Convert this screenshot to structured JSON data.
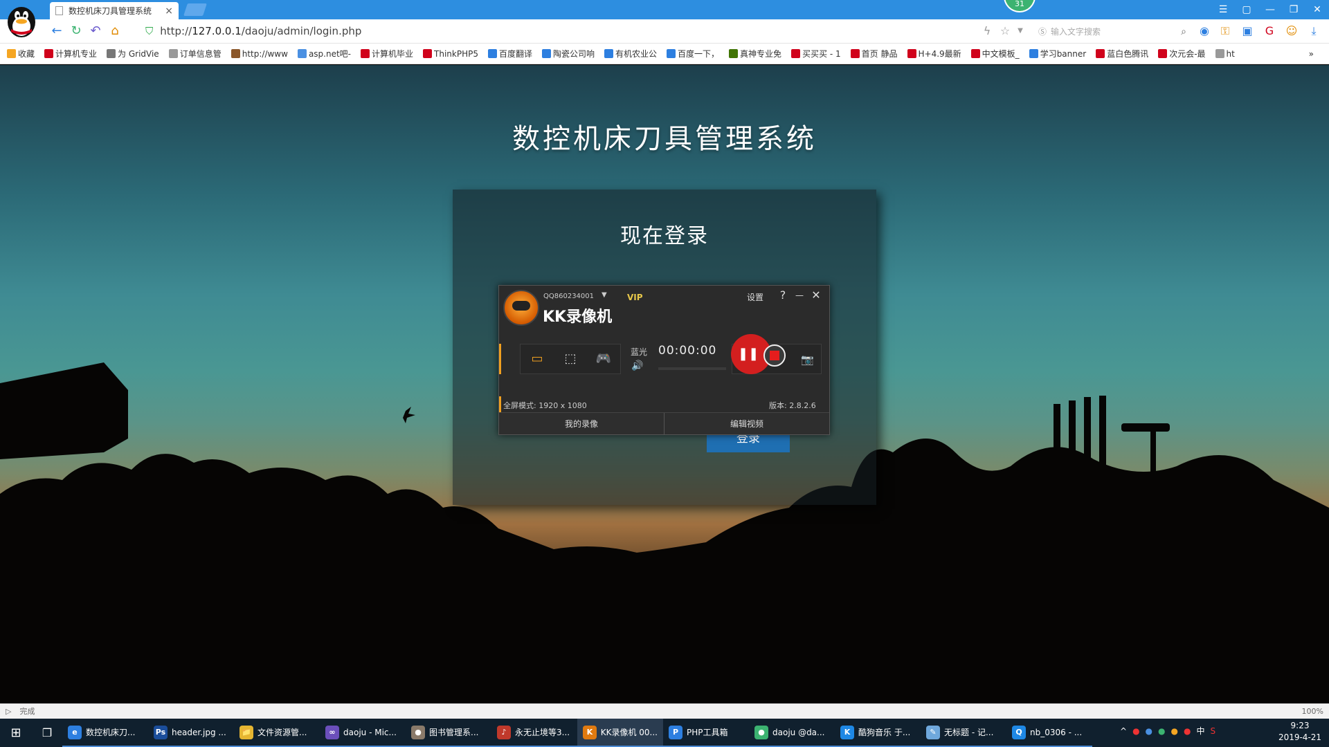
{
  "browser": {
    "tab_title": "数控机床刀具管理系统",
    "tab_close": "×",
    "url_prefix": "http://",
    "url_host": "127.0.0.1",
    "url_path": "/daoju/admin/login.php",
    "search_placeholder": "输入文字搜索",
    "notification_count": "31",
    "status_text": "完成",
    "zoom": "100%"
  },
  "bookmarks": [
    {
      "label": "收藏",
      "color": "#f5a623"
    },
    {
      "label": "计算机专业",
      "color": "#d0021b"
    },
    {
      "label": "为 GridVie",
      "color": "#777777"
    },
    {
      "label": "订单信息管",
      "color": "#999999"
    },
    {
      "label": "http://www",
      "color": "#8b572a"
    },
    {
      "label": "asp.net吧-",
      "color": "#4a90e2"
    },
    {
      "label": "计算机毕业",
      "color": "#d0021b"
    },
    {
      "label": "ThinkPHP5",
      "color": "#d0021b"
    },
    {
      "label": "百度翻译",
      "color": "#2d7fe0"
    },
    {
      "label": "陶瓷公司响",
      "color": "#2d7fe0"
    },
    {
      "label": "有机农业公",
      "color": "#2d7fe0"
    },
    {
      "label": "百度一下，",
      "color": "#2d7fe0"
    },
    {
      "label": "真神专业免",
      "color": "#417505"
    },
    {
      "label": "买买买 - 1",
      "color": "#d0021b"
    },
    {
      "label": "首页 静品",
      "color": "#d0021b"
    },
    {
      "label": "H+4.9最新",
      "color": "#d0021b"
    },
    {
      "label": "中文模板_",
      "color": "#d0021b"
    },
    {
      "label": "学习banner",
      "color": "#2d7fe0"
    },
    {
      "label": "蓝白色腾讯",
      "color": "#d0021b"
    },
    {
      "label": "次元会-最",
      "color": "#d0021b"
    },
    {
      "label": "ht",
      "color": "#999999"
    }
  ],
  "page": {
    "title": "数控机床刀具管理系统",
    "login_title": "现在登录",
    "login_button": "登录"
  },
  "kk_recorder": {
    "account": "QQ860234001",
    "vip": "VIP",
    "app_name": "KK录像机",
    "settings": "设置",
    "help": "?",
    "minimize": "—",
    "close": "✕",
    "bluray": "蓝光",
    "timer": "00:00:00",
    "fullscreen_mode": "全屏模式: 1920 x 1080",
    "version": "版本: 2.8.2.6",
    "my_recordings": "我的录像",
    "edit_video": "编辑视频"
  },
  "taskbar": {
    "items": [
      {
        "label": "数控机床刀...",
        "color": "#2d7fe0",
        "glyph": "e"
      },
      {
        "label": "header.jpg ...",
        "color": "#1b4e9b",
        "glyph": "Ps"
      },
      {
        "label": "文件资源管...",
        "color": "#e5b531",
        "glyph": "📁"
      },
      {
        "label": "daoju - Mic...",
        "color": "#6b4fbb",
        "glyph": "∞"
      },
      {
        "label": "图书管理系...",
        "color": "#8a7a6a",
        "glyph": "●"
      },
      {
        "label": "永无止境等3...",
        "color": "#c0392b",
        "glyph": "♪"
      },
      {
        "label": "KK录像机 00...",
        "color": "#e07a10",
        "glyph": "K"
      },
      {
        "label": "PHP工具箱",
        "color": "#2d7fe0",
        "glyph": "P"
      },
      {
        "label": "daoju @da...",
        "color": "#3cb371",
        "glyph": "●"
      },
      {
        "label": "酷狗音乐 于...",
        "color": "#1e88e5",
        "glyph": "K"
      },
      {
        "label": "无标题 - 记...",
        "color": "#6fa8dc",
        "glyph": "✎"
      },
      {
        "label": "nb_0306 - ...",
        "color": "#1e88e5",
        "glyph": "Q"
      }
    ],
    "ime": "中",
    "time": "9:23",
    "date": "2019-4-21"
  }
}
